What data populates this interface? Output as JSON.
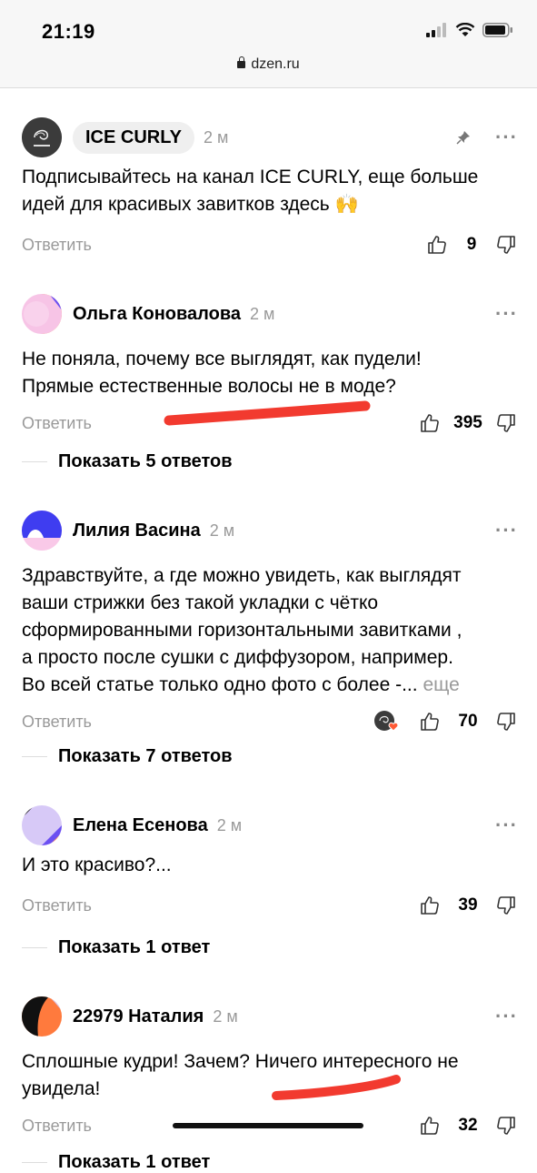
{
  "status": {
    "time": "21:19",
    "url": "dzen.ru"
  },
  "comments": [
    {
      "author": "ICE CURLY",
      "age": "2 м",
      "text": "Подписывайтесь на канал ICE CURLY, еще больше идей для красивых завитков здесь 🙌",
      "reply": "Ответить",
      "likes": "9",
      "avatar_label": "ICE CURLY"
    },
    {
      "author": "Ольга Коновалова",
      "age": "2 м",
      "text_l1": "Не поняла, почему все выглядят, как пудели!",
      "text_l2": "Прямые естественные волосы не в моде?",
      "reply": "Ответить",
      "likes": "395",
      "show_replies": "Показать 5 ответов"
    },
    {
      "author": "Лилия Васина",
      "age": "2 м",
      "text_l1": "Здравствуйте, а где можно увидеть, как выглядят",
      "text_l2": "ваши стрижки без такой укладки с чётко",
      "text_l3": "сформированными горизонтальными завитками ,",
      "text_l4": "а просто после сушки с диффузором, например.",
      "text_l5": "Во всей статье только одно фото с более -...",
      "more": "еще",
      "reply": "Ответить",
      "likes": "70",
      "show_replies": "Показать 7 ответов"
    },
    {
      "author": "Елена Есенова",
      "age": "2 м",
      "text": "И это красиво?...",
      "reply": "Ответить",
      "likes": "39",
      "show_replies": "Показать 1 ответ"
    },
    {
      "author": "22979 Наталия",
      "age": "2 м",
      "text_l1": "Сплошные кудри! Зачем? Ничего интересного не",
      "text_l2": "увидела!",
      "reply": "Ответить",
      "likes": "32",
      "show_replies": "Показать 1 ответ"
    }
  ],
  "colors": {
    "annotation": "#f23a2f",
    "muted": "#999999"
  }
}
